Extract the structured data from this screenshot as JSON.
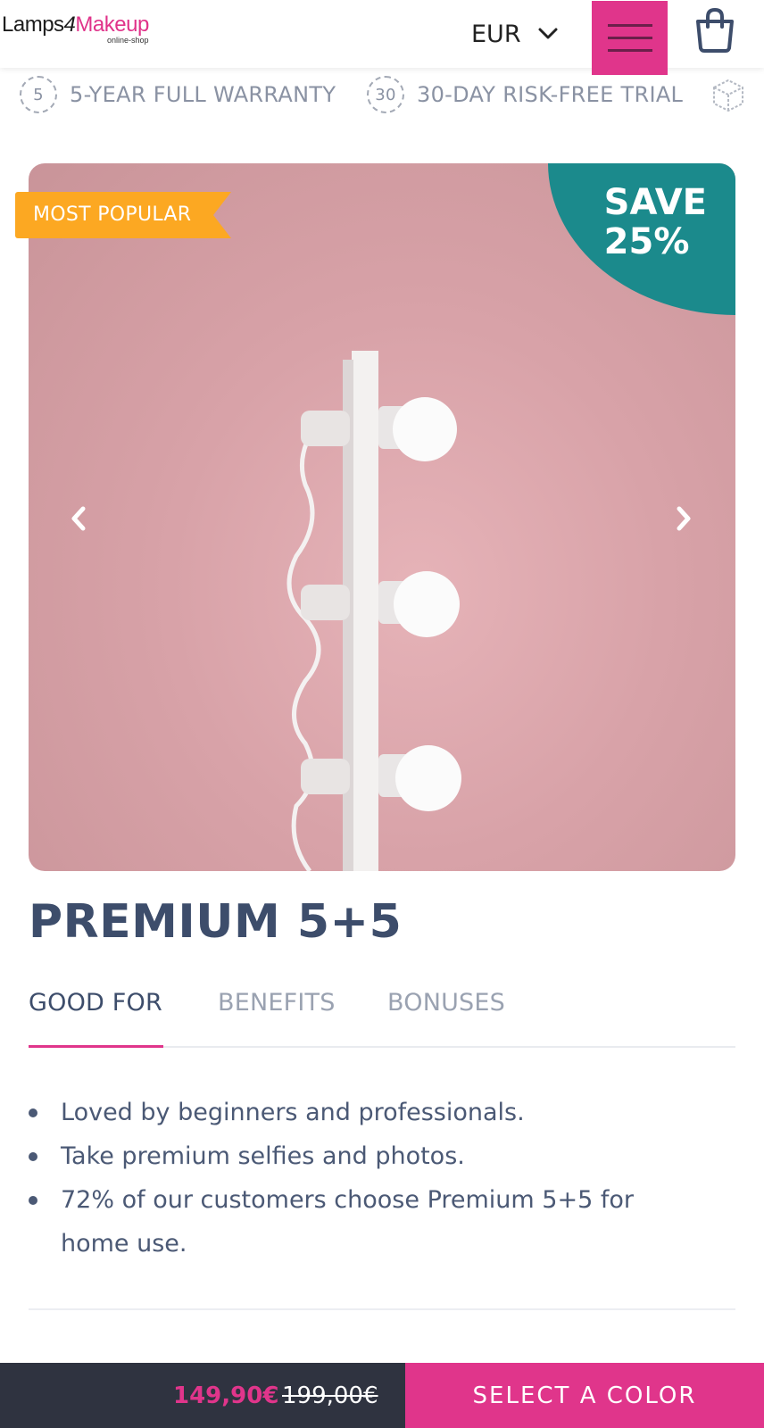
{
  "header": {
    "logo_part1": "Lamps",
    "logo_number": "4",
    "logo_part2": "Makeup",
    "logo_sub": "online-shop",
    "currency": "EUR",
    "accent_color": "#e0358b"
  },
  "trust_bar": {
    "items": [
      {
        "icon": "5",
        "label": "5-YEAR FULL WARRANTY"
      },
      {
        "icon": "30",
        "label": "30-DAY RISK-FREE TRIAL"
      },
      {
        "icon": "box-icon",
        "label": ""
      }
    ]
  },
  "product": {
    "ribbon": "MOST POPULAR",
    "save_line1": "SAVE",
    "save_line2": "25%",
    "title": "PREMIUM 5+5",
    "tabs": [
      "GOOD FOR",
      "BENEFITS",
      "BONUSES"
    ],
    "active_tab": "GOOD FOR",
    "good_for": [
      "Loved by beginners and professionals.",
      "Take premium selfies and photos.",
      "72% of our customers choose Premium 5+5 for home use."
    ]
  },
  "purchase_bar": {
    "price": "149,90€",
    "old_price": "199,00€",
    "cta": "SELECT A COLOR"
  },
  "colors": {
    "pink": "#e0358b",
    "teal": "#1b8a8c",
    "orange": "#fca822",
    "dark": "#2f3340"
  }
}
